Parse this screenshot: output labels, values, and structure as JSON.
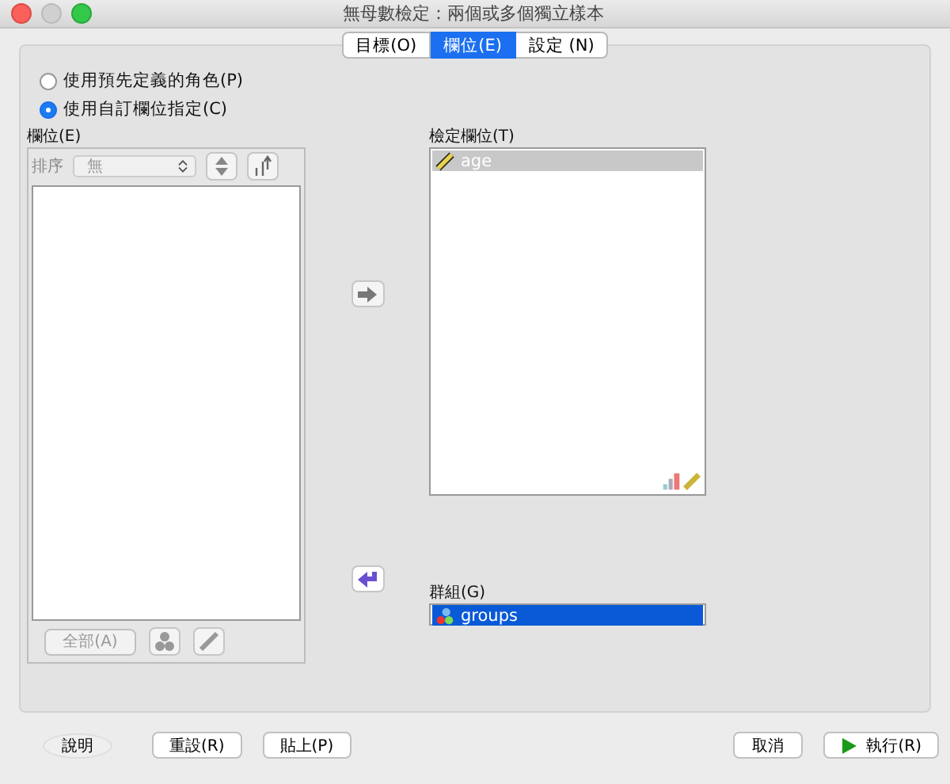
{
  "window": {
    "title": "無母數檢定：兩個或多個獨立樣本"
  },
  "tabs": [
    {
      "label": "目標(O)",
      "selected": false
    },
    {
      "label": "欄位(E)",
      "selected": true
    },
    {
      "label": "設定 (N)",
      "selected": false
    }
  ],
  "assignment_options": [
    {
      "label": "使用預先定義的角色(P)",
      "selected": false
    },
    {
      "label": "使用自訂欄位指定(C)",
      "selected": true
    }
  ],
  "fields_panel": {
    "label": "欄位(E)",
    "sort_label": "排序",
    "sort_value": "無",
    "all_button": "全部(A)"
  },
  "test_fields": {
    "label": "檢定欄位(T)",
    "focused": false,
    "items": [
      {
        "name": "age",
        "selected": true
      }
    ]
  },
  "groups": {
    "label": "群組(G)",
    "focused": true,
    "items": [
      {
        "name": "groups",
        "selected": true
      }
    ]
  },
  "buttons_left": [
    {
      "label": "說明",
      "kind": "help"
    },
    {
      "label": "重設(R)",
      "kind": "plain"
    },
    {
      "label": "貼上(P)",
      "kind": "plain"
    }
  ],
  "buttons_right": [
    {
      "label": "取消",
      "kind": "plain"
    },
    {
      "label": "執行(R)",
      "kind": "run"
    }
  ]
}
